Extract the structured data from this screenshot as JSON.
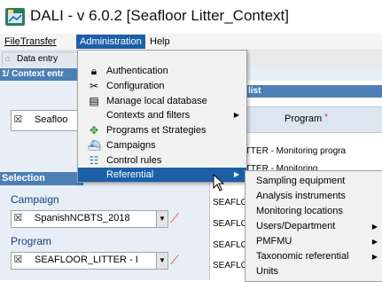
{
  "window": {
    "title": "DALI - v 6.0.2 [Seafloor Litter_Context]"
  },
  "menubar": {
    "items": [
      "File",
      "Transfer",
      "Administration",
      "Help"
    ],
    "active": "Administration"
  },
  "tabs": [
    {
      "label": "Data entry"
    }
  ],
  "context": {
    "header": "1/ Context entr",
    "field_value": "Seafloo"
  },
  "list": {
    "header": "list",
    "program_column": "Program",
    "program_required": "*",
    "rows": [
      "OOR_LITTER - Monitoring progra",
      "OOR_LITTER - Monitoring",
      "SEAFLO",
      "SEAFLC",
      "SEAFLC",
      "SEAFLC"
    ]
  },
  "selection": {
    "header": "Selection",
    "campaign_label": "Campaign",
    "campaign_value": "SpanishNCBTS_2018",
    "program_label": "Program",
    "program_value": "SEAFLOOR_LITTER - I"
  },
  "admin_menu": {
    "items": [
      {
        "label": "Authentication",
        "icon": "lock-icon"
      },
      {
        "label": "Configuration",
        "icon": "tools-icon"
      },
      {
        "label": "Manage local database",
        "icon": "database-icon"
      },
      {
        "label": "Contexts and filters",
        "icon": "",
        "submenu": true
      },
      {
        "label": "Programs et Strategies",
        "icon": "compass-icon"
      },
      {
        "label": "Campaigns",
        "icon": "ship-icon"
      },
      {
        "label": "Control rules",
        "icon": "list-check-icon"
      },
      {
        "label": "Referential",
        "icon": "",
        "submenu": true,
        "highlighted": true
      }
    ]
  },
  "referential_menu": {
    "items": [
      {
        "label": "Sampling equipment"
      },
      {
        "label": "Analysis instruments"
      },
      {
        "label": "Monitoring locations"
      },
      {
        "label": "Users/Department",
        "submenu": true
      },
      {
        "label": "PMFMU",
        "submenu": true
      },
      {
        "label": "Taxonomic referential",
        "submenu": true
      },
      {
        "label": "Units"
      }
    ]
  },
  "colors": {
    "highlight": "#1c5fa8",
    "panel_header": "#4d7fb5",
    "label_blue": "#1a3f80",
    "required_red": "#d33333"
  }
}
